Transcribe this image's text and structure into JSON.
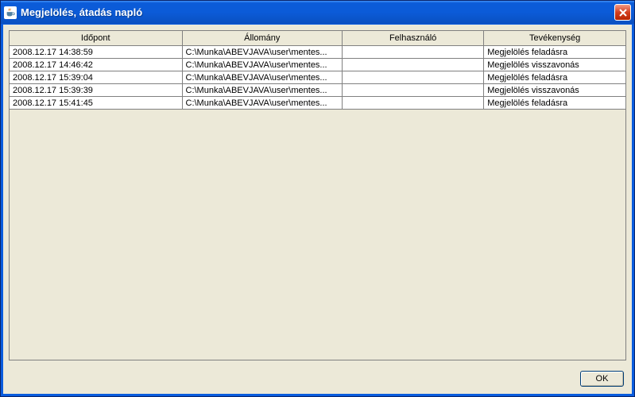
{
  "window": {
    "title": "Megjelölés, átadás napló"
  },
  "table": {
    "headers": {
      "timestamp": "Időpont",
      "file": "Állomány",
      "user": "Felhasználó",
      "activity": "Tevékenység"
    },
    "rows": [
      {
        "timestamp": "2008.12.17 14:38:59",
        "file": "C:\\Munka\\ABEVJAVA\\user\\mentes...",
        "user": "",
        "activity": "Megjelölés feladásra"
      },
      {
        "timestamp": "2008.12.17 14:46:42",
        "file": "C:\\Munka\\ABEVJAVA\\user\\mentes...",
        "user": "",
        "activity": "Megjelölés visszavonás"
      },
      {
        "timestamp": "2008.12.17 15:39:04",
        "file": "C:\\Munka\\ABEVJAVA\\user\\mentes...",
        "user": "",
        "activity": "Megjelölés feladásra"
      },
      {
        "timestamp": "2008.12.17 15:39:39",
        "file": "C:\\Munka\\ABEVJAVA\\user\\mentes...",
        "user": "",
        "activity": "Megjelölés visszavonás"
      },
      {
        "timestamp": "2008.12.17 15:41:45",
        "file": "C:\\Munka\\ABEVJAVA\\user\\mentes...",
        "user": "",
        "activity": "Megjelölés feladásra"
      }
    ]
  },
  "buttons": {
    "ok": "OK"
  }
}
